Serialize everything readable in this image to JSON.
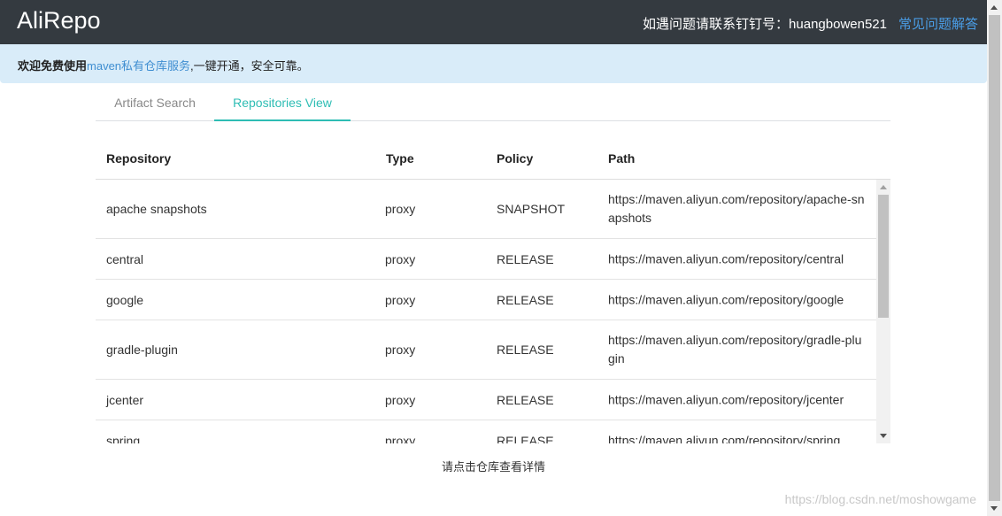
{
  "header": {
    "brand": "AliRepo",
    "contact_text": "如遇问题请联系钉钉号：huangbowen521",
    "faq_label": "常见问题解答"
  },
  "notice": {
    "prefix": "欢迎免费使用",
    "link_text": "maven私有仓库服务",
    "suffix": ",一键开通，安全可靠。"
  },
  "tabs": [
    {
      "label": "Artifact Search",
      "active": false
    },
    {
      "label": "Repositories View",
      "active": true
    }
  ],
  "table": {
    "columns": [
      "Repository",
      "Type",
      "Policy",
      "Path"
    ],
    "rows": [
      {
        "repository": "apache snapshots",
        "type": "proxy",
        "policy": "SNAPSHOT",
        "path": "https://maven.aliyun.com/repository/apache-snapshots"
      },
      {
        "repository": "central",
        "type": "proxy",
        "policy": "RELEASE",
        "path": "https://maven.aliyun.com/repository/central"
      },
      {
        "repository": "google",
        "type": "proxy",
        "policy": "RELEASE",
        "path": "https://maven.aliyun.com/repository/google"
      },
      {
        "repository": "gradle-plugin",
        "type": "proxy",
        "policy": "RELEASE",
        "path": "https://maven.aliyun.com/repository/gradle-plugin"
      },
      {
        "repository": "jcenter",
        "type": "proxy",
        "policy": "RELEASE",
        "path": "https://maven.aliyun.com/repository/jcenter"
      },
      {
        "repository": "spring",
        "type": "proxy",
        "policy": "RELEASE",
        "path": "https://maven.aliyun.com/repository/spring"
      }
    ]
  },
  "hint": "请点击仓库查看详情",
  "watermark": "https://blog.csdn.net/moshowgame",
  "colors": {
    "header_bg": "#343a40",
    "notice_bg": "#d9ecf9",
    "accent_teal": "#2ebdb4",
    "link_blue": "#4a9de6"
  }
}
